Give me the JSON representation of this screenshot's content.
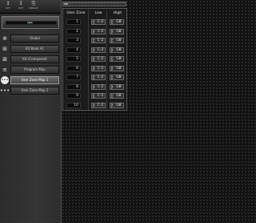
{
  "toolbar": {
    "tools": [
      {
        "glyph": "↥",
        "label": "SET",
        "icon": "upload-icon"
      },
      {
        "glyph": "↧",
        "label": "GET",
        "icon": "download-icon"
      },
      {
        "glyph": "⎘",
        "label": "LIBRARY",
        "icon": "library-icon"
      }
    ]
  },
  "device": {
    "screen_text": "▮▮▮▮"
  },
  "sidebar": {
    "items": [
      {
        "label": "Global",
        "icon": "globe-icon",
        "glyph": "⊕"
      },
      {
        "label": "Kit Bank A1",
        "icon": "kit-icon",
        "glyph": "⊞"
      },
      {
        "label": "Kit (Compared)",
        "icon": "compare-icon",
        "glyph": "⊠"
      },
      {
        "label": "Program Map",
        "icon": "map-icon",
        "glyph": "≡"
      },
      {
        "label": "User Zone Map 1",
        "icon": "zone-icon",
        "glyph": "•••",
        "active": true
      },
      {
        "label": "User Zone Map 2",
        "icon": "zone-icon",
        "glyph": "•••"
      }
    ]
  },
  "zone_table": {
    "headers": {
      "zone": "User Zone",
      "low": "Low",
      "high": "High"
    },
    "rows": [
      {
        "zone": "1",
        "low": "C-2",
        "high": "G8"
      },
      {
        "zone": "2",
        "low": "C-2",
        "high": "G8"
      },
      {
        "zone": "3",
        "low": "C-2",
        "high": "G8"
      },
      {
        "zone": "4",
        "low": "C-2",
        "high": "G8"
      },
      {
        "zone": "5",
        "low": "C-2",
        "high": "G8"
      },
      {
        "zone": "6",
        "low": "C-2",
        "high": "G8"
      },
      {
        "zone": "7",
        "low": "C-2",
        "high": "G8"
      },
      {
        "zone": "8",
        "low": "C-2",
        "high": "G8"
      },
      {
        "zone": "9",
        "low": "C-2",
        "high": "G8"
      },
      {
        "zone": "10",
        "low": "C-2",
        "high": "G8"
      }
    ]
  }
}
